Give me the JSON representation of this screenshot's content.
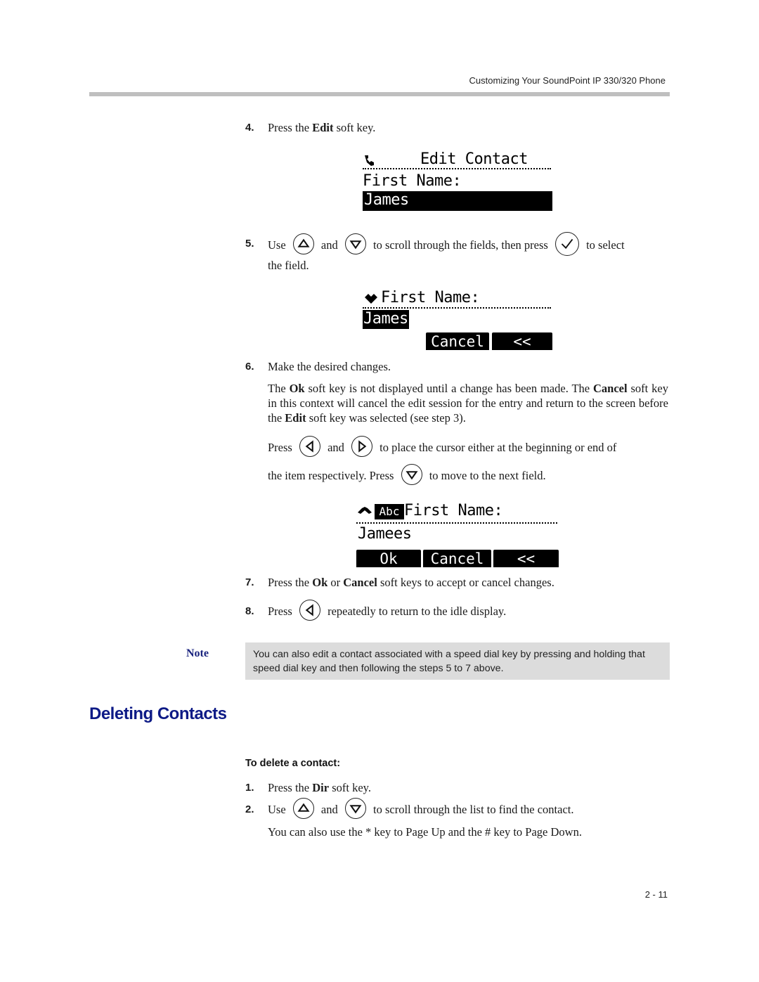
{
  "header": {
    "running_title": "Customizing Your SoundPoint IP 330/320 Phone"
  },
  "steps_part1": [
    {
      "num": "4.",
      "pre": "Press the ",
      "bold": "Edit",
      "post": " soft key."
    },
    {
      "num": "5.",
      "w1": "Use",
      "w2": "and",
      "w3": "to scroll through the fields, then press",
      "w4": "to select",
      "line2": "the field."
    },
    {
      "num": "6.",
      "text": "Make the desired changes."
    }
  ],
  "step6_details": {
    "p1": {
      "a": "The ",
      "b1": "Ok",
      "c": " soft key is not displayed until a change has been made. The ",
      "b2": "Cancel",
      "d": " soft key in this context will cancel the edit session for the entry and return to the screen before the ",
      "b3": "Edit",
      "e": " soft key was selected (see step 3)."
    },
    "p2": {
      "w1": "Press",
      "w2": "and",
      "w3": "to place the cursor either at the beginning or end of",
      "line2a": "the item respectively. Press",
      "line2b": "to move to the next field."
    }
  },
  "steps_part2": [
    {
      "num": "7.",
      "a": "Press the ",
      "b1": "Ok",
      "c": " or ",
      "b2": "Cancel",
      "d": " soft keys to accept or cancel changes."
    },
    {
      "num": "8.",
      "a": "Press",
      "b": "repeatedly to return to the idle display."
    }
  ],
  "screens": {
    "s1": {
      "title": "Edit Contact",
      "label": "First Name:",
      "value": "James"
    },
    "s2": {
      "label": "First Name:",
      "value": "James",
      "softkeys": [
        "Cancel",
        "<<"
      ]
    },
    "s3": {
      "mode": "Abc",
      "label": "First Name:",
      "value": "Jamees",
      "softkeys": [
        "Ok",
        "Cancel",
        "<<"
      ]
    }
  },
  "note": {
    "label": "Note",
    "text": "You can also edit a contact associated with a speed dial key by pressing and holding that speed dial key and then following the steps 5 to 7 above."
  },
  "section": {
    "title": "Deleting Contacts",
    "procedure_heading": "To delete a contact:",
    "steps": [
      {
        "num": "1.",
        "a": "Press the ",
        "bold": "Dir",
        "b": " soft key."
      },
      {
        "num": "2.",
        "w1": "Use",
        "w2": "and",
        "w3": "to scroll through the list to find the contact.",
        "line2": "You can also use the * key to Page Up and the # key to Page Down."
      }
    ]
  },
  "footer": {
    "page_number": "2 - 11"
  },
  "icons": {
    "up": "up-arrow-key-icon",
    "down": "down-arrow-key-icon",
    "select": "select-check-key-icon",
    "left": "left-arrow-key-icon",
    "right": "right-arrow-key-icon"
  }
}
